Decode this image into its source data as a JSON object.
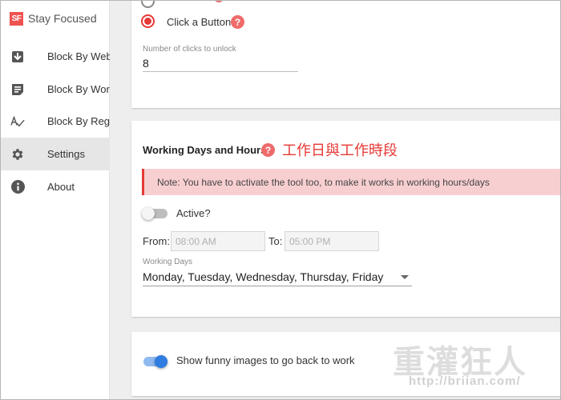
{
  "brand": {
    "logo_text": "SF",
    "name": "Stay Focused",
    "logo_color": "#ef5350"
  },
  "sidebar": {
    "items": [
      {
        "label": "Block By Website",
        "icon": "block-site-icon",
        "active": false
      },
      {
        "label": "Block By Words",
        "icon": "block-words-icon",
        "active": false
      },
      {
        "label": "Block By Regex",
        "icon": "regex-icon",
        "active": false
      },
      {
        "label": "Settings",
        "icon": "gear-icon",
        "active": true
      },
      {
        "label": "About",
        "icon": "info-icon",
        "active": false
      }
    ]
  },
  "unlock_card": {
    "option_label": "Click a Button",
    "help": "?",
    "clicks_label": "Number of clicks to unlock",
    "clicks_value": "8"
  },
  "working_card": {
    "title": "Working Days and Hours",
    "help": "?",
    "annotation": "工作日與工作時段",
    "note": "Note: You have to activate the tool too, to make it works in working hours/days",
    "active_label": "Active?",
    "active": false,
    "from_label": "From:",
    "from_value": "08:00 AM",
    "to_label": "To:",
    "to_value": "05:00 PM",
    "days_label": "Working Days",
    "days_value": "Monday, Tuesday, Wednesday, Thursday, Friday"
  },
  "images_card": {
    "label": "Show funny images to go back to work",
    "enabled": true
  },
  "watermark": {
    "name": "重灌狂人",
    "url": "http://briian.com/"
  },
  "colors": {
    "accent_red": "#e53935",
    "toggle_blue": "#2f7de1",
    "note_bg": "#f8cfd1"
  }
}
